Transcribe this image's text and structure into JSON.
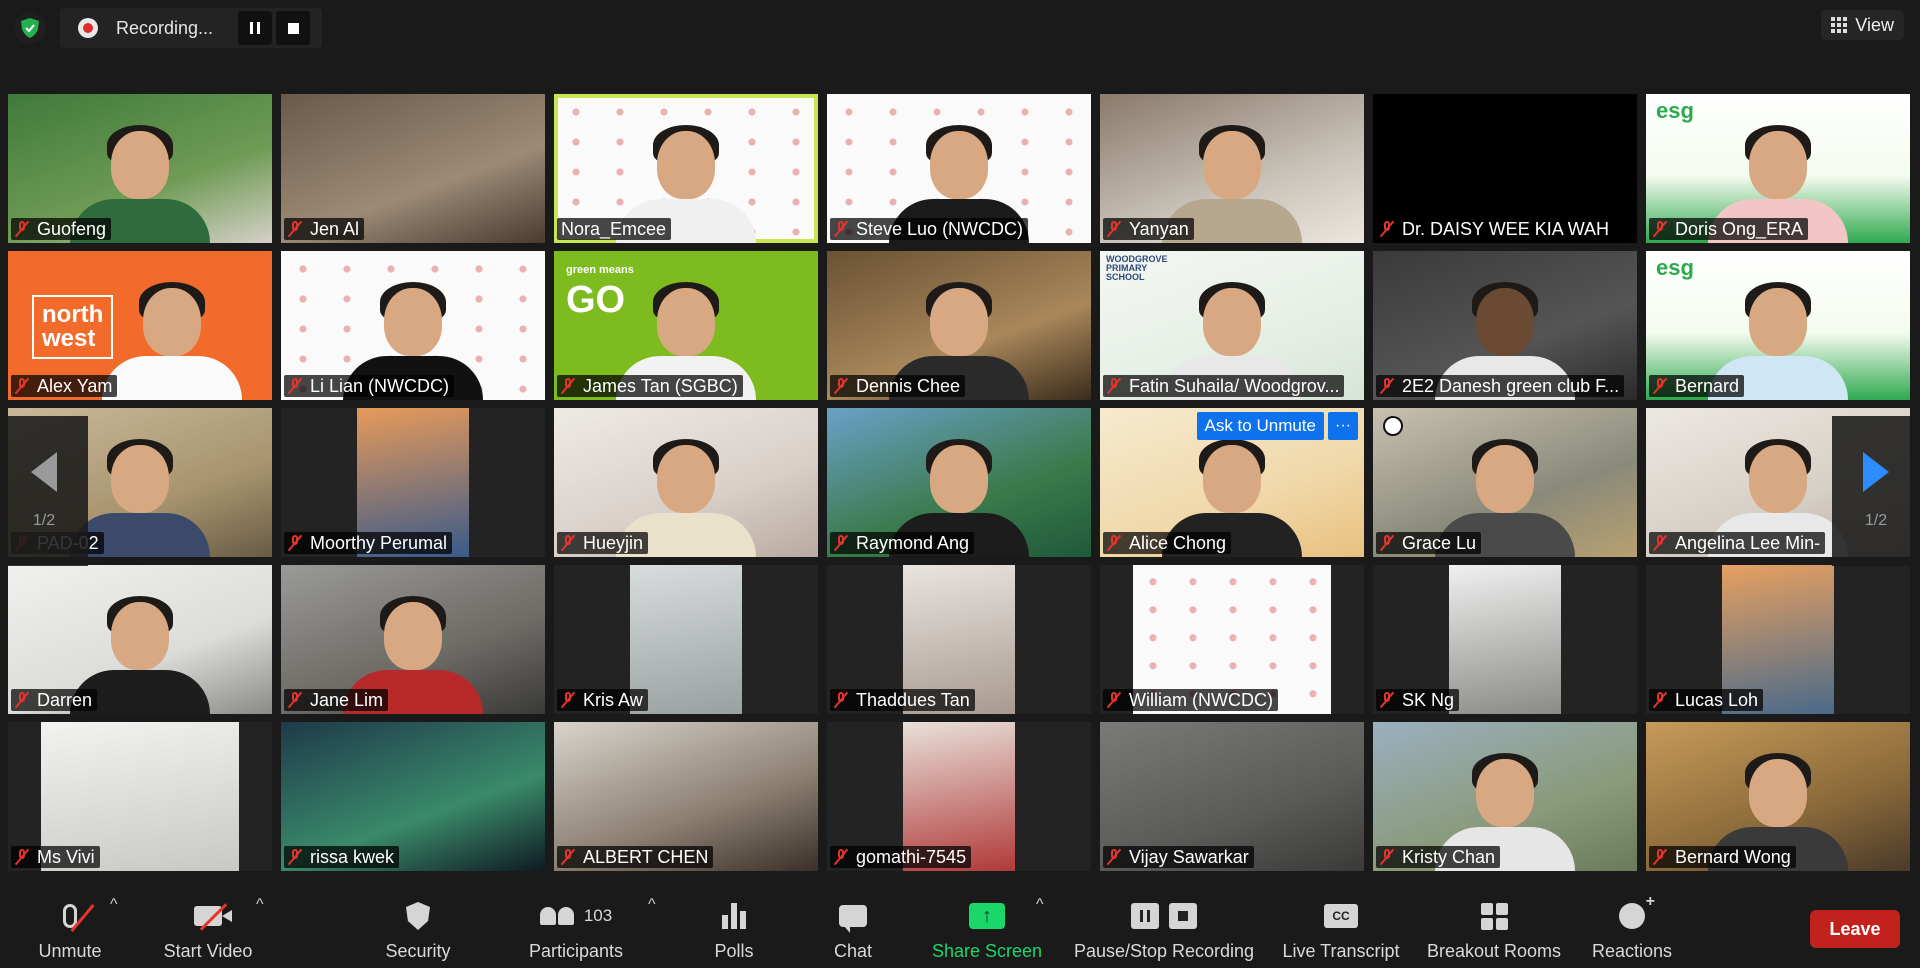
{
  "top_bar": {
    "recording_label": "Recording...",
    "view_label": "View"
  },
  "participants": [
    {
      "name": "Guofeng"
    },
    {
      "name": "Jen Al"
    },
    {
      "name": "Nora_Emcee"
    },
    {
      "name": "Steve Luo (NWCDC)"
    },
    {
      "name": "Yanyan"
    },
    {
      "name": "Dr. DAISY WEE KIA WAH"
    },
    {
      "name": "Doris Ong_ERA"
    },
    {
      "name": "Alex Yam"
    },
    {
      "name": "Li Lian (NWCDC)"
    },
    {
      "name": "James Tan (SGBC)"
    },
    {
      "name": "Dennis Chee"
    },
    {
      "name": "Fatin Suhaila/ Woodgrov..."
    },
    {
      "name": "2E2 Danesh green club F..."
    },
    {
      "name": "Bernard"
    },
    {
      "name": "PAD-02"
    },
    {
      "name": "Moorthy Perumal"
    },
    {
      "name": "Hueyjin"
    },
    {
      "name": "Raymond Ang"
    },
    {
      "name": "Alice Chong"
    },
    {
      "name": "Grace Lu"
    },
    {
      "name": "Angelina Lee Min-"
    },
    {
      "name": "Darren"
    },
    {
      "name": "Jane Lim"
    },
    {
      "name": "Kris Aw"
    },
    {
      "name": "Thaddues Tan"
    },
    {
      "name": "William (NWCDC)"
    },
    {
      "name": "SK Ng"
    },
    {
      "name": "Lucas Loh"
    },
    {
      "name": "Ms Vivi"
    },
    {
      "name": "rissa kwek"
    },
    {
      "name": "ALBERT CHEN"
    },
    {
      "name": "gomathi-7545"
    },
    {
      "name": "Vijay Sawarkar"
    },
    {
      "name": "Kristy Chan"
    },
    {
      "name": "Bernard Wong"
    }
  ],
  "backgrounds": {
    "northwest_logo": "north\nwest",
    "esg_logo": "esg",
    "green_means": "green means",
    "go_logo": "GO",
    "school_logo": "WOODGROVE PRIMARY SCHOOL"
  },
  "ask_to_unmute_label": "Ask to Unmute",
  "more_label": "···",
  "paging": {
    "left_label": "1/2",
    "right_label": "1/2"
  },
  "toolbar": {
    "unmute": "Unmute",
    "start_video": "Start Video",
    "security": "Security",
    "participants": "Participants",
    "participant_count": "103",
    "polls": "Polls",
    "chat": "Chat",
    "share_screen": "Share Screen",
    "pause_stop_recording": "Pause/Stop Recording",
    "live_transcript": "Live Transcript",
    "cc_label": "CC",
    "breakout_rooms": "Breakout Rooms",
    "reactions": "Reactions",
    "leave": "Leave"
  },
  "colors": {
    "active_speaker_border": "#c8e651",
    "share_green": "#1bd76a",
    "leave_red": "#c2221d",
    "ask_unmute_blue": "#0e72ed",
    "muted_red": "#e5342c"
  }
}
